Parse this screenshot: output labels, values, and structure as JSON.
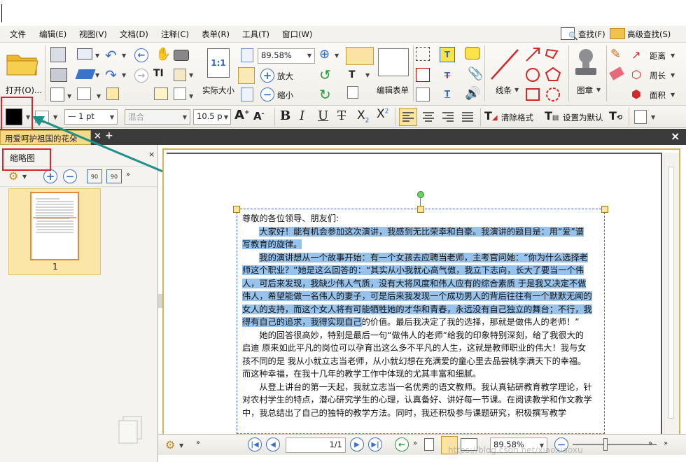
{
  "menu": [
    "文件",
    "编辑(E)",
    "视图(V)",
    "文档(D)",
    "注释(C)",
    "表单(R)",
    "工具(T)",
    "窗口(W)"
  ],
  "menu_right": {
    "find": "查找(F)",
    "advanced_find": "高级查找(S)"
  },
  "ribbon": {
    "open_label": "打开(O)...",
    "zoom_value": "89.58%",
    "actual_size": "实际大小",
    "zoom_in": "放大",
    "zoom_out": "缩小",
    "edit_form": "编辑表单",
    "line": "线条",
    "stamp": "图章",
    "distance": "距离",
    "perimeter": "周长",
    "area": "面积",
    "fit_label": "1:1"
  },
  "format": {
    "line_width": "1 pt",
    "font_name": "混合",
    "font_size": "10.5 p",
    "clear_format": "清除格式",
    "set_default": "设置为默认"
  },
  "tab": {
    "title": "用爱呵护祖国的花朵"
  },
  "panel": {
    "title": "缩略图",
    "page_num": "1",
    "rotate_left": "90",
    "rotate_right": "90"
  },
  "document": {
    "greeting": "尊敬的各位领导、朋友们:",
    "p1": "大家好！能有机会参加这次演讲，我感到无比荣幸和自豪。我演讲的题目是：用“爱”谱写教育的旋律。",
    "p2_hl": "我的演讲想从一个故事开始：有一个女孩去应聘当老师，主考官问她：“你为什么选择老师这个职业？”她是这么回答的：“其实从小我就心高气傲，我立下志向，长大了要当一个伟人，可后来发现，我缺少伟人气质，没有大将风度和伟人应有的综合素质 于是我又决定不做伟人，希望能做一名伟人的妻子，可是后来我发现一个成功男人的背后往往有一个默默无闻的女人的支持，而这个女人将有可能牺牲她的才华和青春，永远没有自己独立的舞台；不行，我得有自己的追求，我得实现自己",
    "p2_rest": "的价值。最后我决定了我的选择，那就是做伟人的老师！”",
    "p3": "她的回答很高妙，特别是最后一句“做伟人的老师”给我的印象特别深刻，给了我很大的启迪 原来如此平凡的岗位可以孕育出这么多不平凡的人生，这就是教师职业的伟大！我与女孩不同的是 我从小就立志当老师，从小就幻想在充满爱的童心里去品尝桃李满天下的幸福。而这种幸福，在我十几年的教学工作中体现的尤其丰富和细腻。",
    "p4": "从登上讲台的第一天起，我就立志当一名优秀的语文教师。我认真钻研教育教学理论，针对农村学生的特点，潜心研究学生的心理，认真备好、讲好每一节课。在阅读教学和作文教学中，我总结出了自己的独特的教学方法。同时，我还积极参与课题研究，积极撰写教学"
  },
  "status": {
    "page": "1",
    "page_total": "/1",
    "zoom": "89.58%"
  },
  "watermark": "https://blog.csdn.net/xiaoxiaoxu",
  "colors": {
    "accent_tab": "#f5d98a",
    "highlight": "#97c2ec",
    "annot_red": "#e0202a",
    "arrow_teal": "#1f8f8a"
  }
}
